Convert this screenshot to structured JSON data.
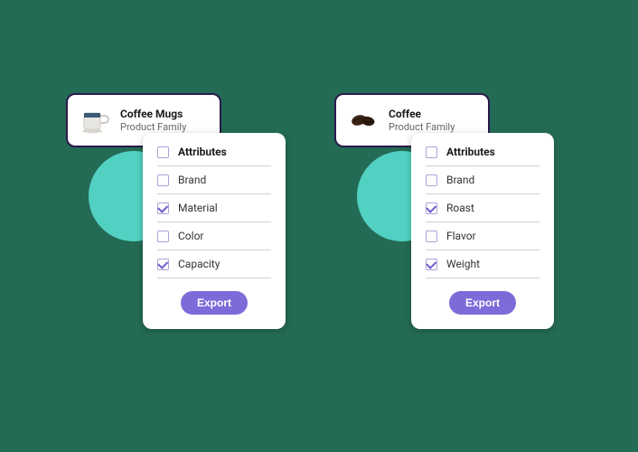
{
  "groups": [
    {
      "product": {
        "title": "Coffee Mugs",
        "subtitle": "Product Family",
        "icon": "mug"
      },
      "attributes_header": "Attributes",
      "attributes": [
        {
          "label": "Brand",
          "checked": false
        },
        {
          "label": "Material",
          "checked": true
        },
        {
          "label": "Color",
          "checked": false
        },
        {
          "label": "Capacity",
          "checked": true
        }
      ],
      "export_label": "Export"
    },
    {
      "product": {
        "title": "Coffee",
        "subtitle": "Product Family",
        "icon": "beans"
      },
      "attributes_header": "Attributes",
      "attributes": [
        {
          "label": "Brand",
          "checked": false
        },
        {
          "label": "Roast",
          "checked": true
        },
        {
          "label": "Flavor",
          "checked": false
        },
        {
          "label": "Weight",
          "checked": true
        }
      ],
      "export_label": "Export"
    }
  ]
}
